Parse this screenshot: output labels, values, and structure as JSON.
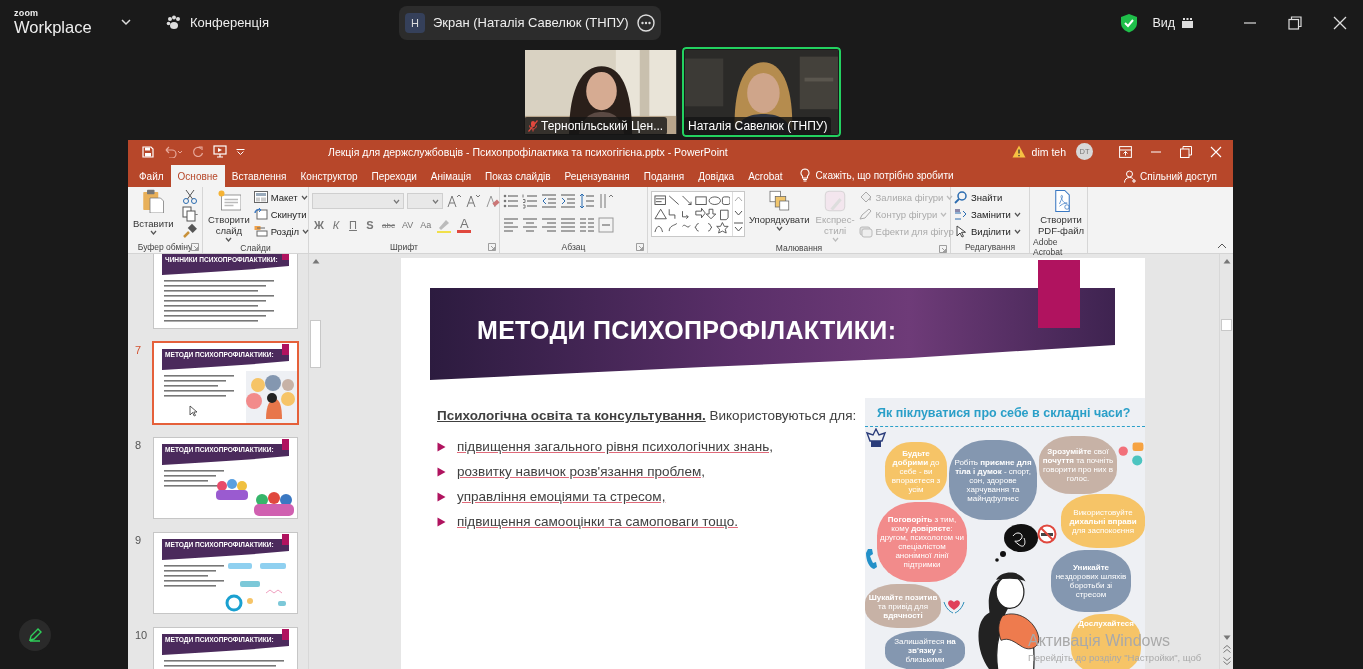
{
  "zoom_bar": {
    "logo_small": "zoom",
    "logo": "Workplace",
    "meeting": "Конференція",
    "share_badge": "Н",
    "share_label": "Экран (Наталія Савелюк (ТНПУ)",
    "view": "Вид"
  },
  "video_tiles": [
    {
      "name": "Тернопільський Цен...",
      "muted": true,
      "speaking": false
    },
    {
      "name": "Наталія Савелюк (ТНПУ)",
      "muted": false,
      "speaking": true
    }
  ],
  "powerpoint": {
    "title": "Лекція для держслужбовців - Психопрофілактика та психогігієна.pptx  -  PowerPoint",
    "user": "dim teh",
    "avatar": "DT",
    "tabs": [
      {
        "label": "Файл",
        "selected": false
      },
      {
        "label": "Основне",
        "selected": true
      },
      {
        "label": "Вставлення",
        "selected": false
      },
      {
        "label": "Конструктор",
        "selected": false
      },
      {
        "label": "Переходи",
        "selected": false
      },
      {
        "label": "Анімація",
        "selected": false
      },
      {
        "label": "Показ слайдів",
        "selected": false
      },
      {
        "label": "Рецензування",
        "selected": false
      },
      {
        "label": "Подання",
        "selected": false
      },
      {
        "label": "Довідка",
        "selected": false
      },
      {
        "label": "Acrobat",
        "selected": false
      }
    ],
    "tell_me": "Скажіть, що потрібно зробити",
    "share": "Спільний доступ",
    "ribbon": [
      {
        "kind": "clipboard",
        "label": "Буфер обміну",
        "large": [
          {
            "label": "Вставити",
            "menu": true,
            "disabled": false
          }
        ]
      },
      {
        "kind": "slides",
        "label": "Слайди",
        "large": [
          {
            "label": "Створити слайд",
            "menu": true,
            "disabled": false
          }
        ],
        "small": [
          {
            "label": "Макет",
            "menu": true,
            "disabled": false
          },
          {
            "label": "Скинути",
            "menu": false,
            "disabled": false
          },
          {
            "label": "Розділ",
            "menu": true,
            "disabled": false
          }
        ]
      },
      {
        "kind": "font",
        "label": "Шрифт",
        "format": [
          "Ж",
          "К",
          "П",
          "S",
          "abc",
          "AV",
          "Aa",
          "A"
        ]
      },
      {
        "kind": "paragraph",
        "label": "Абзац"
      },
      {
        "kind": "drawing",
        "label": "Малювання",
        "large": [
          {
            "label": "Упорядкувати",
            "menu": true,
            "disabled": false
          },
          {
            "label": "Експрес-стилі",
            "menu": true,
            "disabled": true
          }
        ],
        "small": [
          {
            "label": "Заливка фігури",
            "menu": true,
            "disabled": true
          },
          {
            "label": "Контур фігури",
            "menu": true,
            "disabled": true
          },
          {
            "label": "Ефекти для фігур",
            "menu": true,
            "disabled": true
          }
        ]
      },
      {
        "kind": "editing",
        "label": "Редагування",
        "small": [
          {
            "label": "Знайти",
            "menu": false,
            "disabled": false
          },
          {
            "label": "Замінити",
            "menu": true,
            "disabled": false
          },
          {
            "label": "Виділити",
            "menu": true,
            "disabled": false
          }
        ]
      },
      {
        "kind": "acrobat",
        "label": "Adobe Acrobat",
        "large": [
          {
            "label": "Створити PDF-файл",
            "menu": false,
            "disabled": false
          }
        ]
      }
    ],
    "thumbnails": [
      {
        "title": "ЧИННИКИ ПСИХОПРОФІЛАКТИКИ:",
        "kind": "text",
        "selected": false
      },
      {
        "number": "7",
        "title": "МЕТОДИ ПСИХОПРОФІЛАКТИКИ:",
        "kind": "infographic",
        "selected": true
      },
      {
        "number": "8",
        "title": "МЕТОДИ ПСИХОПРОФІЛАКТИКИ:",
        "kind": "people",
        "selected": false
      },
      {
        "number": "9",
        "title": "МЕТОДИ ПСИХОПРОФІЛАКТИКИ:",
        "kind": "diagram",
        "selected": false
      },
      {
        "number": "10",
        "title": "МЕТОДИ ПСИХОПРОФІЛАКТИКИ:",
        "kind": "text_image",
        "selected": false
      }
    ],
    "slide": {
      "title": "МЕТОДИ ПСИХОПРОФІЛАКТИКИ:",
      "intro": "**Психологічна освіта та консультування.** Використовуються для:",
      "bullets": [
        "підвищення загального рівня психологічних знань,",
        "розвитку навичок розв'язання проблем,",
        "управління емоціями та стресом,",
        "підвищення самооцінки та самоповаги тощо."
      ],
      "infographic": {
        "heading": "Як піклуватися про себе в складні часи?",
        "bubbles": [
          {
            "text": "**Будьте добрими** до себе - ви впораєтеся з усім",
            "color": "#f6c467"
          },
          {
            "text": "Робіть **приємне для тіла і думок** - спорт, сон, здорове харчування та майндфулнес",
            "color": "#8497b0"
          },
          {
            "text": "**Зрозумійте** свої **почуття** та почніть говорити про них в голос.",
            "color": "#c7b2a6"
          },
          {
            "text": "**Поговоріть** з тим, кому **довіряєте**: другом, психологом чи спеціалістом анонімної лінії підтримки",
            "color": "#f28b8b"
          },
          {
            "text": "Використовуйте **дихальні вправи** для заспокоєння",
            "color": "#f6c467"
          },
          {
            "text": "**Шукайте позитив** та привід для **вдячності**",
            "color": "#c7b2a6"
          },
          {
            "text": "**Уникайте** нездорових шляхів боротьби зі стресом",
            "color": "#8497b0"
          },
          {
            "text": "Залишайтеся **на зв'язку** з близькими",
            "color": "#8497b0"
          },
          {
            "text": "**Дослухайтеся**",
            "color": "#f6c467"
          }
        ]
      }
    },
    "activation": {
      "title": "Активація Windows",
      "hint": "Перейдіть до розділу \"Настройки\", щоб"
    }
  }
}
